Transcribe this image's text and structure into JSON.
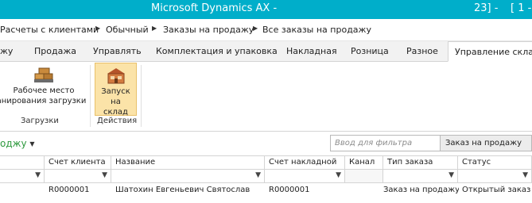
{
  "titlebar": {
    "title": "Microsoft Dynamics AX -",
    "right_text": "23] -",
    "min_label": "[ 1 -"
  },
  "breadcrumb": {
    "items": [
      "Расчеты с клиентами",
      "Обычный",
      "Заказы на продажу",
      "Все заказы на продажу"
    ],
    "separator": "▶"
  },
  "tabs": [
    "жу",
    "Продажа",
    "Управлять",
    "Комплектация и упаковка",
    "Накладная",
    "Розница",
    "Разное",
    "Управление склад"
  ],
  "ribbon": {
    "group1": {
      "button_line1": "Рабочее место",
      "button_line2": "анирования загрузки",
      "label": "Загрузки"
    },
    "group2": {
      "button_line1": "Запуск на",
      "button_line2": "склад",
      "label": "Действия"
    }
  },
  "list": {
    "title": "оджу",
    "filter_placeholder": "Ввод для фильтра",
    "filter_field": "Заказ на продажу"
  },
  "grid": {
    "columns": [
      "Счет клиента",
      "Название",
      "Счет накладной",
      "Канал",
      "Тип заказа",
      "Статус"
    ],
    "rows": [
      {
        "account": "R0000001",
        "name": "Шатохин Евгеньевич Святослав",
        "invoice_account": "R0000001",
        "channel": "",
        "order_type": "Заказ на продажу",
        "status": "Открытый заказ"
      }
    ]
  },
  "colors": {
    "titlebar": "#00aeca",
    "list_title": "#2e9a3e",
    "selected_button": "#fbe3a8"
  }
}
